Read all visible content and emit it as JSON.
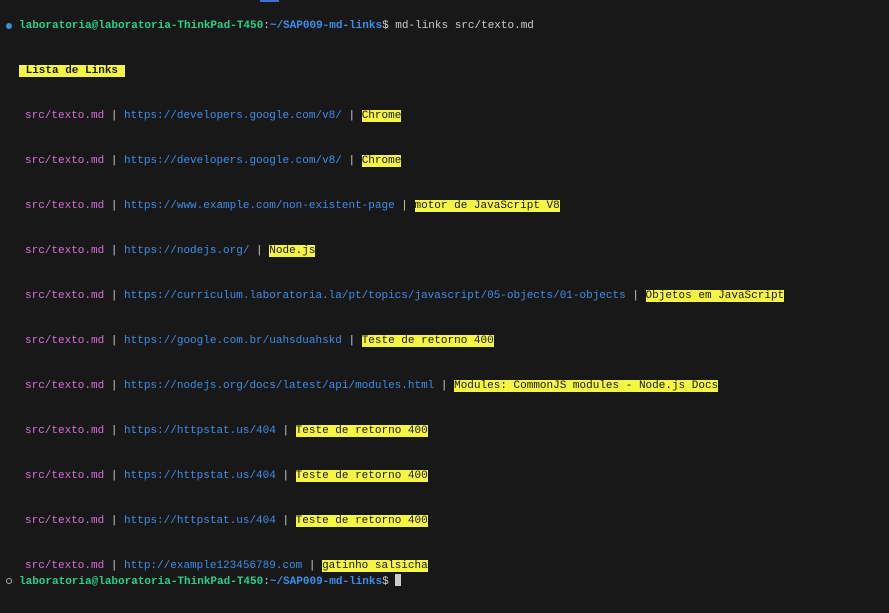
{
  "prompt": {
    "user": "laboratoria@laboratoria-ThinkPad-T450",
    "colon": ":",
    "path": "~/SAP009-md-links",
    "symbol": "$",
    "command": " md-links src/texto.md"
  },
  "list_title": " Lista de Links ",
  "separator": " | ",
  "links": [
    {
      "file": "src/texto.md",
      "url": "https://developers.google.com/v8/",
      "text": "Chrome"
    },
    {
      "file": "src/texto.md",
      "url": "https://developers.google.com/v8/",
      "text": "Chrome"
    },
    {
      "file": "src/texto.md",
      "url": "https://www.example.com/non-existent-page",
      "text": "motor de JavaScript V8"
    },
    {
      "file": "src/texto.md",
      "url": "https://nodejs.org/",
      "text": "Node.js"
    },
    {
      "file": "src/texto.md",
      "url": "https://curriculum.laboratoria.la/pt/topics/javascript/05-objects/01-objects",
      "text": "Objetos em JavaScript"
    },
    {
      "file": "src/texto.md",
      "url": "https://google.com.br/uahsduahskd",
      "text": "Teste de retorno 400"
    },
    {
      "file": "src/texto.md",
      "url": "https://nodejs.org/docs/latest/api/modules.html",
      "text": "Modules: CommonJS modules - Node.js Docs"
    },
    {
      "file": "src/texto.md",
      "url": "https://httpstat.us/404",
      "text": "Teste de retorno 400"
    },
    {
      "file": "src/texto.md",
      "url": "https://httpstat.us/404",
      "text": "Teste de retorno 400"
    },
    {
      "file": "src/texto.md",
      "url": "https://httpstat.us/404",
      "text": "Teste de retorno 400"
    },
    {
      "file": "src/texto.md",
      "url": "http://example123456789.com",
      "text": "gatinho salsicha"
    }
  ],
  "final_prompt": {
    "user": "laboratoria@laboratoria-ThinkPad-T450",
    "colon": ":",
    "path": "~/SAP009-md-links",
    "symbol": "$ "
  },
  "colors": {
    "background": "#181818",
    "user": "#23d18b",
    "path": "#3b8eea",
    "file": "#d670d6",
    "url": "#3b8eea",
    "highlight": "#f5f543"
  }
}
